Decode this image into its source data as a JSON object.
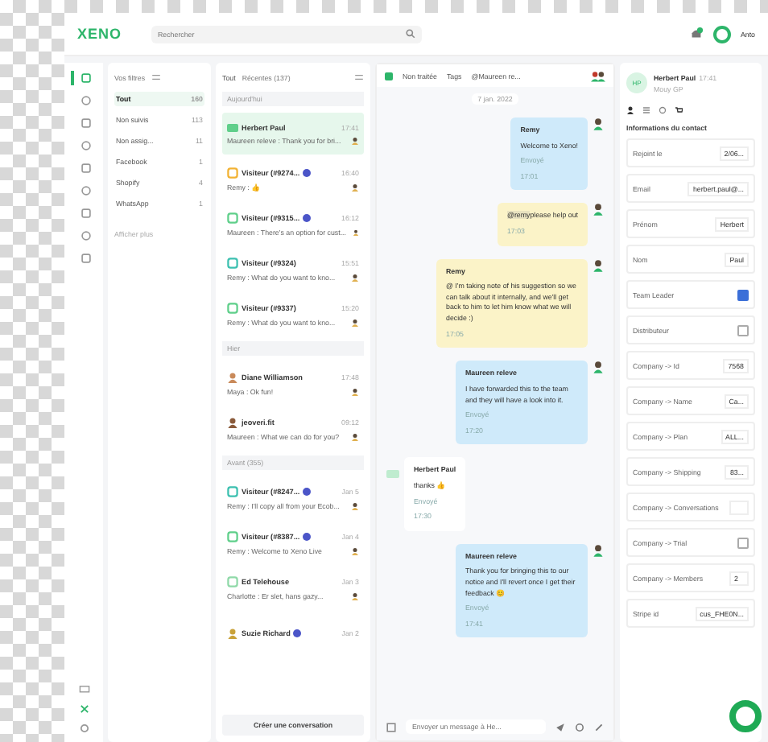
{
  "topbar": {
    "logo": "XENO",
    "search": {
      "placeholder": "Rechercher"
    },
    "user": "Anto"
  },
  "rail": [
    {
      "selected": true
    },
    {
      "selected": false
    },
    {
      "selected": false
    },
    {
      "selected": false
    },
    {
      "selected": false
    },
    {
      "selected": false
    },
    {
      "selected": false
    },
    {
      "selected": false
    },
    {
      "selected": false
    }
  ],
  "filters": {
    "title": "Vos filtres",
    "items": [
      {
        "label": "Tout",
        "count": "160",
        "selected": true
      },
      {
        "label": "Non suivis",
        "count": "113",
        "selected": false
      },
      {
        "label": "Non assig...",
        "count": "11",
        "selected": false
      },
      {
        "label": "Facebook",
        "count": "1",
        "selected": false
      },
      {
        "label": "Shopify",
        "count": "4",
        "selected": false
      },
      {
        "label": "WhatsApp",
        "count": "1",
        "selected": false
      }
    ],
    "more": "Afficher plus"
  },
  "conversations": {
    "scope": "Tout",
    "sort": "Récentes (137)",
    "groups": [
      {
        "title": "Aujourd'hui",
        "items": [
          {
            "name": "Herbert Paul",
            "time": "17:41",
            "preview": "Maureen releve : Thank you for bri...",
            "kind": "initials",
            "color": "#5fcf8a",
            "badge": false,
            "selected": true
          },
          {
            "name": "Visiteur (#9274...",
            "time": "16:40",
            "preview": "Remy : 👍",
            "kind": "visitor",
            "color": "#f2b233",
            "badge": true,
            "selected": false
          },
          {
            "name": "Visiteur (#9315...",
            "time": "16:12",
            "preview": "Maureen : There's an option for cust...",
            "kind": "visitor",
            "color": "#5fcf8a",
            "badge": true,
            "selected": false
          },
          {
            "name": "Visiteur (#9324)",
            "time": "15:51",
            "preview": "Remy : What do you want to kno...",
            "kind": "visitor",
            "color": "#3cc0b0",
            "badge": false,
            "selected": false
          },
          {
            "name": "Visiteur (#9337)",
            "time": "15:20",
            "preview": "Remy : What do you want to kno...",
            "kind": "visitor",
            "color": "#5fcf8a",
            "badge": false,
            "selected": false
          }
        ]
      },
      {
        "title": "Hier",
        "items": [
          {
            "name": "Diane Williamson",
            "time": "17:48",
            "preview": "Maya : Ok fun!",
            "kind": "person",
            "color": "#c98a5a",
            "badge": false,
            "selected": false
          },
          {
            "name": "jeoveri.fit",
            "time": "09:12",
            "preview": "Maureen : What we can do for you?",
            "kind": "person",
            "color": "#8a5a3a",
            "badge": false,
            "selected": false
          }
        ]
      },
      {
        "title": "Avant (355)",
        "items": [
          {
            "name": "Visiteur (#8247...",
            "time": "Jan 5",
            "preview": "Remy : I'll copy all from your Ecob...",
            "kind": "visitor",
            "color": "#3cc0b0",
            "badge": true,
            "selected": false
          },
          {
            "name": "Visiteur (#8387...",
            "time": "Jan 4",
            "preview": "Remy : Welcome to Xeno Live",
            "kind": "visitor",
            "color": "#5fcf8a",
            "badge": true,
            "selected": false
          },
          {
            "name": "Ed Telehouse",
            "time": "Jan 3",
            "preview": "Charlotte : Er slet, hans gazy...",
            "kind": "visitor",
            "color": "#8fd9a8",
            "badge": false,
            "selected": false
          },
          {
            "name": "Suzie Richard",
            "time": "Jan 2",
            "kind": "person",
            "color": "#c9a23a",
            "badge": true,
            "selected": false
          }
        ]
      }
    ],
    "create": "Créer une conversation"
  },
  "chat": {
    "header": {
      "status": "Non traitée",
      "tags": "Tags",
      "assignee": "@Maureen re..."
    },
    "date": "7 jan. 2022",
    "messages": [
      {
        "kind": "agent",
        "author": "Remy",
        "text": "Welcome to Xeno!",
        "status": "Envoyé",
        "time": "17:01"
      },
      {
        "kind": "note",
        "mention": "@remy",
        "text": "please help out",
        "time": "17:03"
      },
      {
        "kind": "note",
        "author": "Remy",
        "text": "@ I'm taking note of his suggestion so we can talk about it internally, and we'll get back to him to let him know what we will decide :)",
        "time": "17:05"
      },
      {
        "kind": "agent",
        "author": "Maureen releve",
        "text": "I have forwarded this to the team and they will have a look into it.",
        "status": "Envoyé",
        "time": "17:20"
      },
      {
        "kind": "customer",
        "author": "Herbert Paul",
        "text": "thanks 👍",
        "status": "Envoyé",
        "time": "17:30"
      },
      {
        "kind": "agent",
        "author": "Maureen releve",
        "text": "Thank you for bringing this to our notice and I'll revert once I get their feedback 😊",
        "status": "Envoyé",
        "time": "17:41"
      }
    ],
    "composer": {
      "placeholder": "Envoyer un message à He..."
    }
  },
  "contact": {
    "name": "Herbert Paul",
    "initials": "HP",
    "subtitle": "Mouy GP",
    "time": "17:41",
    "section": "Informations du contact",
    "fields": [
      {
        "kind": "text",
        "label": "Rejoint le",
        "value": "2/06..."
      },
      {
        "kind": "text",
        "label": "Email",
        "value": "herbert.paul@..."
      },
      {
        "kind": "text",
        "label": "Prénom",
        "value": "Herbert"
      },
      {
        "kind": "text",
        "label": "Nom",
        "value": "Paul"
      },
      {
        "kind": "checkbox",
        "label": "Team Leader",
        "checked": true
      },
      {
        "kind": "checkbox",
        "label": "Distributeur",
        "checked": false
      },
      {
        "kind": "text",
        "label": "Company -> Id",
        "value": "7568"
      },
      {
        "kind": "text",
        "label": "Company -> Name",
        "value": "Ca..."
      },
      {
        "kind": "text",
        "label": "Company -> Plan",
        "value": "ALL..."
      },
      {
        "kind": "text",
        "label": "Company -> Shipping",
        "value": "83..."
      },
      {
        "kind": "text",
        "label": "Company -> Conversations"
      },
      {
        "kind": "checkbox",
        "label": "Company -> Trial",
        "checked": false
      },
      {
        "kind": "text",
        "label": "Company -> Members",
        "value": "2"
      },
      {
        "kind": "text",
        "label": "Stripe id",
        "value": "cus_FHE0N..."
      }
    ]
  }
}
